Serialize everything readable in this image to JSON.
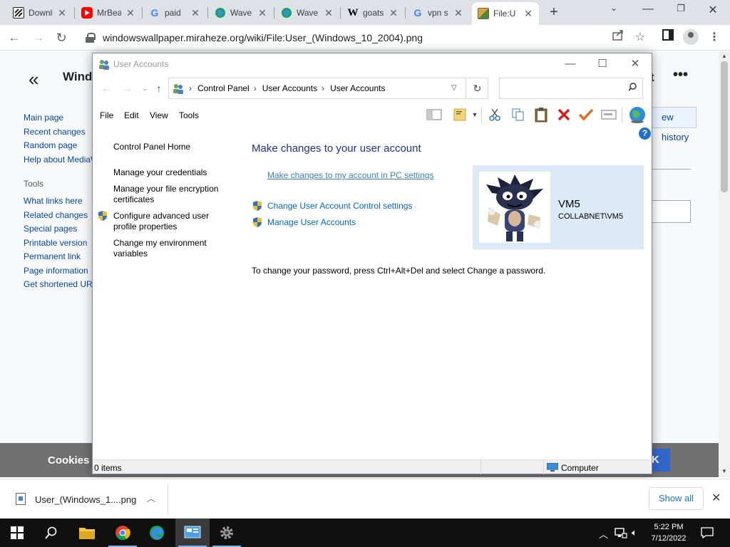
{
  "browser": {
    "tabs": [
      {
        "title": "Download",
        "favicon": "zip-icon",
        "color": "#222222"
      },
      {
        "title": "MrBeast",
        "favicon": "youtube-icon",
        "color": "#ff0000"
      },
      {
        "title": "paid",
        "favicon": "google-icon",
        "color": "#4285f4"
      },
      {
        "title": "Wave",
        "favicon": "edge-icon",
        "color": "#1aa260"
      },
      {
        "title": "Wave",
        "favicon": "edge-icon",
        "color": "#1aa260"
      },
      {
        "title": "goats",
        "favicon": "wikipedia-icon",
        "color": "#000000"
      },
      {
        "title": "vpn s",
        "favicon": "google-icon",
        "color": "#4285f4"
      },
      {
        "title": "File:U",
        "favicon": "wiki-file-icon",
        "color": "#8b5a2b",
        "active": true
      }
    ],
    "new_tab": "+",
    "url": "windowswallpaper.miraheze.org/wiki/File:User_(Windows_10_2004).png"
  },
  "wiki": {
    "collapse": "«",
    "site_title": "Windo",
    "nav": [
      "Main page",
      "Recent changes",
      "Random page",
      "Help about MediaW"
    ],
    "tools_heading": "Tools",
    "tools": [
      "What links here",
      "Related changes",
      "Special pages",
      "Printable version",
      "Permanent link",
      "Page information",
      "Get shortened UR"
    ],
    "right_title": "t",
    "more": "•••",
    "history_button": "ew history",
    "cookies_label": "Cookies",
    "cookies_ok": "K"
  },
  "window": {
    "title": "User Accounts",
    "breadcrumb": [
      "Control Panel",
      "User Accounts",
      "User Accounts"
    ],
    "menu": [
      "File",
      "Edit",
      "View",
      "Tools"
    ],
    "left_links": [
      {
        "label": "Control Panel Home",
        "shield": false
      },
      {
        "label": "Manage your credentials",
        "shield": false
      },
      {
        "label": "Manage your file encryption certificates",
        "shield": false
      },
      {
        "label": "Configure advanced user profile properties",
        "shield": true
      },
      {
        "label": "Change my environment variables",
        "shield": false
      }
    ],
    "heading": "Make changes to your user account",
    "pc_settings_link": "Make changes to my account in PC settings",
    "uac_link": "Change User Account Control settings",
    "manage_link": "Manage User Accounts",
    "password_hint": "To change your password, press Ctrl+Alt+Del and select Change a password.",
    "user": {
      "name": "VM5",
      "domain": "COLLABNET\\VM5"
    },
    "status_items": "0 items",
    "status_location": "Computer",
    "help": "?"
  },
  "downloads": {
    "file": "User_(Windows_1....png",
    "show_all": "Show all"
  },
  "taskbar": {
    "time": "5:22 PM",
    "date": "7/12/2022"
  }
}
